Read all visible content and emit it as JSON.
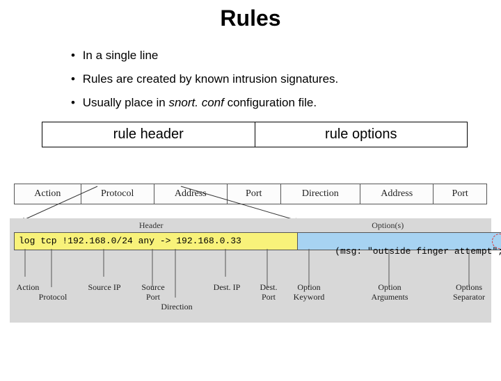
{
  "title": "Rules",
  "bullets": {
    "b1": "In a single line",
    "b2": "Rules are created by known intrusion signatures.",
    "b3a": "Usually place in ",
    "b3b": "snort. conf",
    "b3c": " configuration file."
  },
  "twobox": {
    "left": "rule header",
    "right": "rule options"
  },
  "diag1": {
    "c1": "Action",
    "c2": "Protocol",
    "c3": "Address",
    "c4": "Port",
    "c5": "Direction",
    "c6": "Address",
    "c7": "Port"
  },
  "diag2": {
    "top_left": "Header",
    "top_right": "Option(s)",
    "rule_left": "log tcp !192.168.0/24 any -> 192.168.0.33",
    "rule_right": "(msg: \"outside finger attempt\";)",
    "labels": {
      "l1": "Action",
      "l2": "Protocol",
      "l3": "Source IP",
      "l4": "Source",
      "l4b": "Port",
      "l5": "Direction",
      "l6": "Dest. IP",
      "l7": "Dest.",
      "l7b": "Port",
      "l8": "Option",
      "l8b": "Keyword",
      "l9": "Option",
      "l9b": "Arguments",
      "l10": "Options",
      "l10b": "Separator"
    }
  }
}
